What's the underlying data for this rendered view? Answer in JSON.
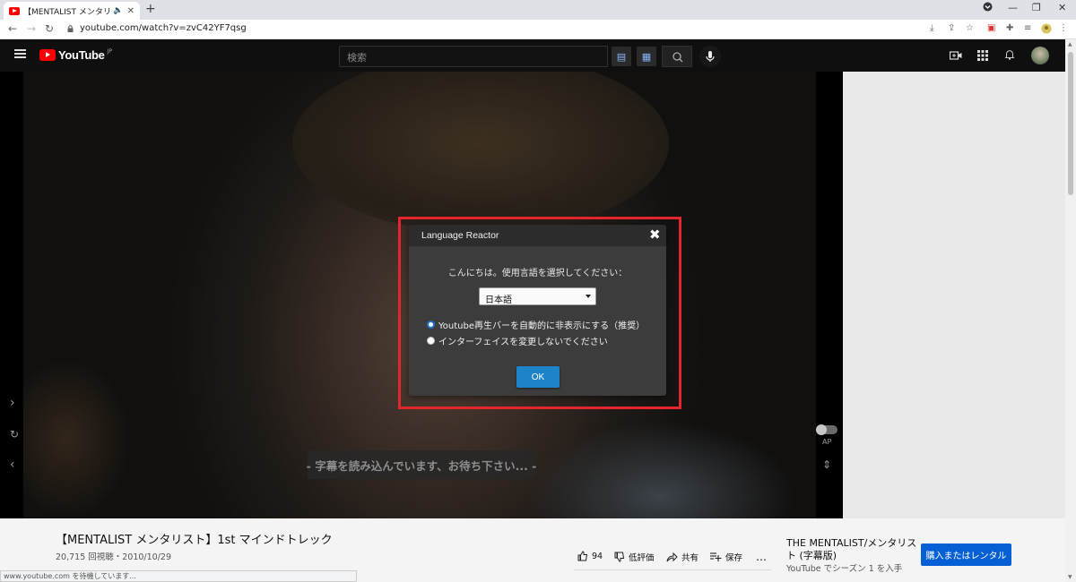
{
  "browser": {
    "tab_title": "【MENTALIST メンタリスト】1st",
    "tab_audio": "🔈",
    "tab_close": "✕",
    "new_tab": "+",
    "url": "youtube.com/watch?v=zvC42YF7qsg",
    "back": "←",
    "forward": "→",
    "reload": "↻",
    "minimize": "—",
    "restore": "❐",
    "close": "✕"
  },
  "youtube": {
    "logo_text": "YouTube",
    "logo_region": "JP",
    "search_placeholder": "検索"
  },
  "player": {
    "subtitle_loading": "- 字幕を読み込んでいます、お待ち下さい... -",
    "ap_label": "AP",
    "next_icon": "›",
    "prev_icon": "‹",
    "repeat_icon": "↻",
    "updown_icon": "⇕"
  },
  "dialog": {
    "title": "Language Reactor",
    "close": "✖",
    "prompt": "こんにちは。使用言語を選択してください：",
    "language_selected": "日本語",
    "option_1": "Youtube再生バーを自動的に非表示にする（推奨）",
    "option_2": "インターフェイスを変更しないでください",
    "selected_option": 1,
    "ok": "OK",
    "highlight_color": "#e3252d",
    "ok_color": "#1d84c9"
  },
  "video": {
    "title": "【MENTALIST メンタリスト】1st マインドトレック",
    "meta": "20,715 回視聴・2010/10/29",
    "likes": "94",
    "dislike_label": "低評価",
    "share_label": "共有",
    "save_label": "保存",
    "more_label": "…"
  },
  "promo": {
    "title": "THE MENTALIST/メンタリスト (字幕版)",
    "subtitle": "YouTube でシーズン 1 を入手",
    "button": "購入またはレンタル"
  },
  "status_text": "www.youtube.com を待機しています..."
}
